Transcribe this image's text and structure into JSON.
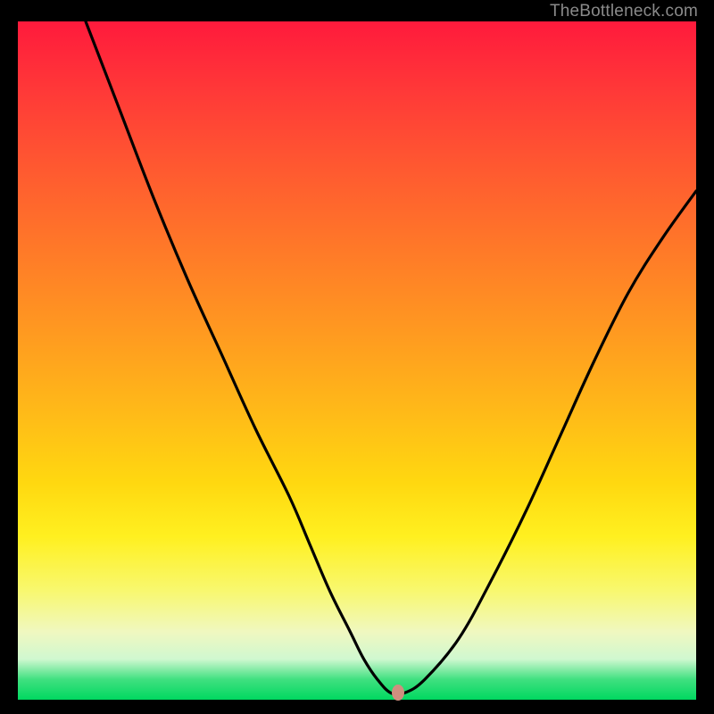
{
  "watermark": "TheBottleneck.com",
  "chart_data": {
    "type": "line",
    "title": "",
    "xlabel": "",
    "ylabel": "",
    "xlim": [
      0,
      100
    ],
    "ylim": [
      0,
      100
    ],
    "background_gradient": {
      "top": "#ff1a3c",
      "mid": "#ffd810",
      "bottom": "#00d860"
    },
    "series": [
      {
        "name": "bottleneck-curve",
        "x": [
          10,
          15,
          20,
          25,
          30,
          35,
          40,
          43,
          46,
          49,
          51,
          53,
          55,
          57,
          60,
          65,
          70,
          75,
          80,
          85,
          90,
          95,
          100
        ],
        "y": [
          100,
          87,
          74,
          62,
          51,
          40,
          30,
          23,
          16,
          10,
          6,
          3,
          1,
          1,
          3,
          9,
          18,
          28,
          39,
          50,
          60,
          68,
          75
        ]
      }
    ],
    "marker": {
      "x": 56,
      "y": 1,
      "color": "#cf8f7f"
    }
  }
}
